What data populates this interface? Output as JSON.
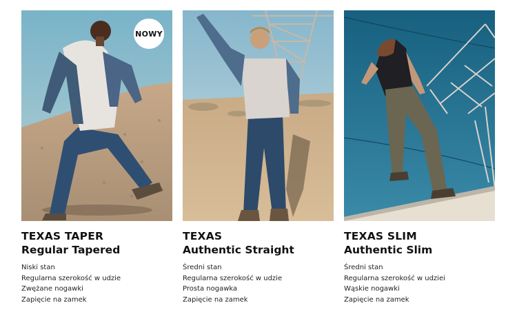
{
  "products": [
    {
      "badge": "NOWY",
      "title": "TEXAS TAPER",
      "subtitle": "Regular Tapered",
      "features": [
        "Niski stan",
        "Regularna szerokość w udzie",
        "Zwężane nogawki",
        "Zapięcie na zamek"
      ]
    },
    {
      "title": "TEXAS",
      "subtitle": "Authentic Straight",
      "features": [
        "Średni stan",
        "Regularna szerokość w udzie",
        "Prosta nogawka",
        "Zapięcie na zamek"
      ]
    },
    {
      "title": "TEXAS SLIM",
      "subtitle": "Authentic Slim",
      "features": [
        "Średni stan",
        "Regularna szerokość w udziei",
        "Wąskie nogawki",
        "Zapięcie na zamek"
      ]
    }
  ],
  "colors": {
    "text": "#111111",
    "badge_bg": "#ffffff",
    "sky_1": "#7fb4c9",
    "sky_3": "#1f6f8f",
    "sand": "#c9a981"
  }
}
